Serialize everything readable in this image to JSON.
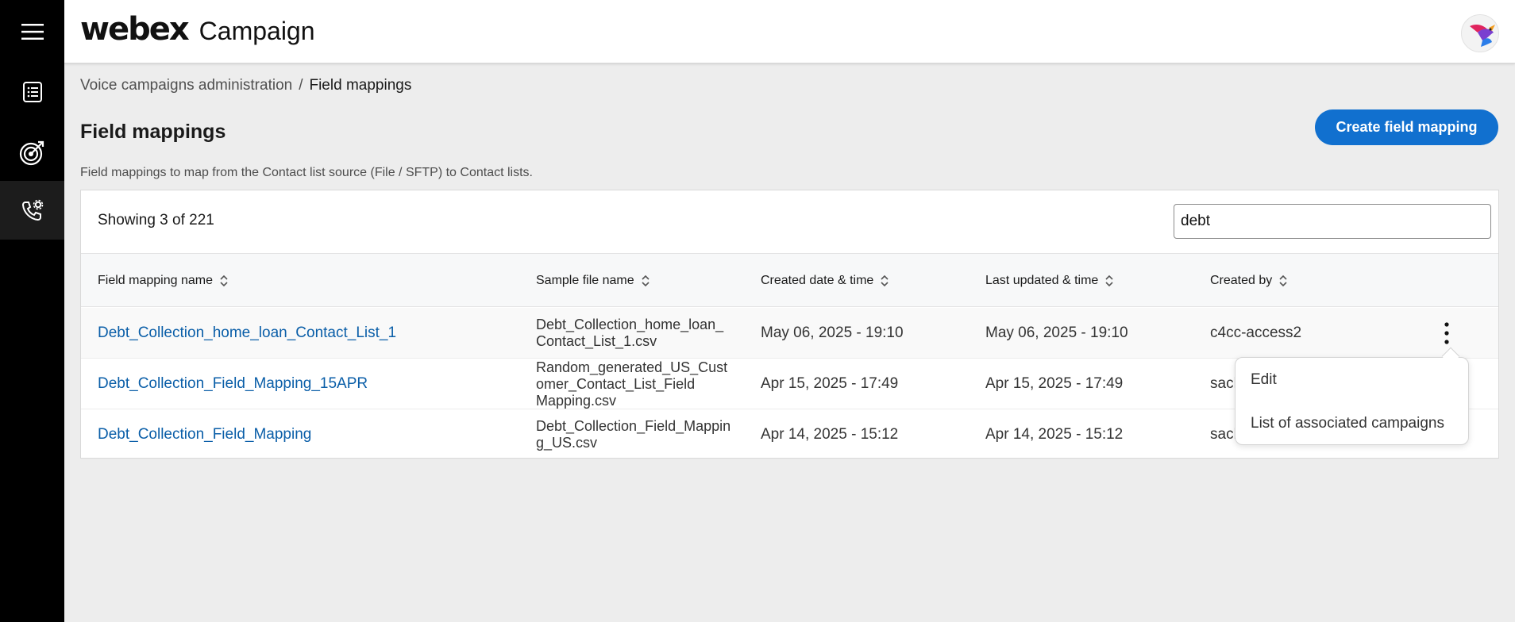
{
  "app": {
    "logo": "webex",
    "product": "Campaign"
  },
  "nav": [
    {
      "name": "list-icon",
      "active": false
    },
    {
      "name": "target-icon",
      "active": false
    },
    {
      "name": "phone-settings-icon",
      "active": true
    }
  ],
  "breadcrumb": {
    "parent": "Voice campaigns administration",
    "separator": "/",
    "current": "Field mappings"
  },
  "page": {
    "title": "Field mappings",
    "description": "Field mappings to map from the Contact list source (File / SFTP) to Contact lists.",
    "create_button": "Create field mapping"
  },
  "table": {
    "showing": "Showing 3 of 221",
    "search": {
      "value": "debt"
    },
    "columns": [
      "Field mapping name",
      "Sample file name",
      "Created date & time",
      "Last updated & time",
      "Created by"
    ],
    "rows": [
      {
        "name": "Debt_Collection_home_loan_Contact_List_1",
        "file": "Debt_Collection_home_loan_\nContact_List_1.csv",
        "created": "May 06, 2025 - 19:10",
        "updated": "May 06, 2025 - 19:10",
        "by": "c4cc-access2"
      },
      {
        "name": "Debt_Collection_Field_Mapping_15APR",
        "file": "Random_generated_US_Cust\nomer_Contact_List_Field\nMapping.csv",
        "created": "Apr 15, 2025 - 17:49",
        "updated": "Apr 15, 2025 - 17:49",
        "by": "sach"
      },
      {
        "name": "Debt_Collection_Field_Mapping",
        "file": "Debt_Collection_Field_Mappin\ng_US.csv",
        "created": "Apr 14, 2025 - 15:12",
        "updated": "Apr 14, 2025 - 15:12",
        "by": "sach"
      }
    ]
  },
  "context_menu": {
    "items": [
      "Edit",
      "List of associated campaigns"
    ]
  },
  "colors": {
    "accent": "#1170cf",
    "link": "#0a5ea8",
    "nav_bg": "#000000"
  }
}
